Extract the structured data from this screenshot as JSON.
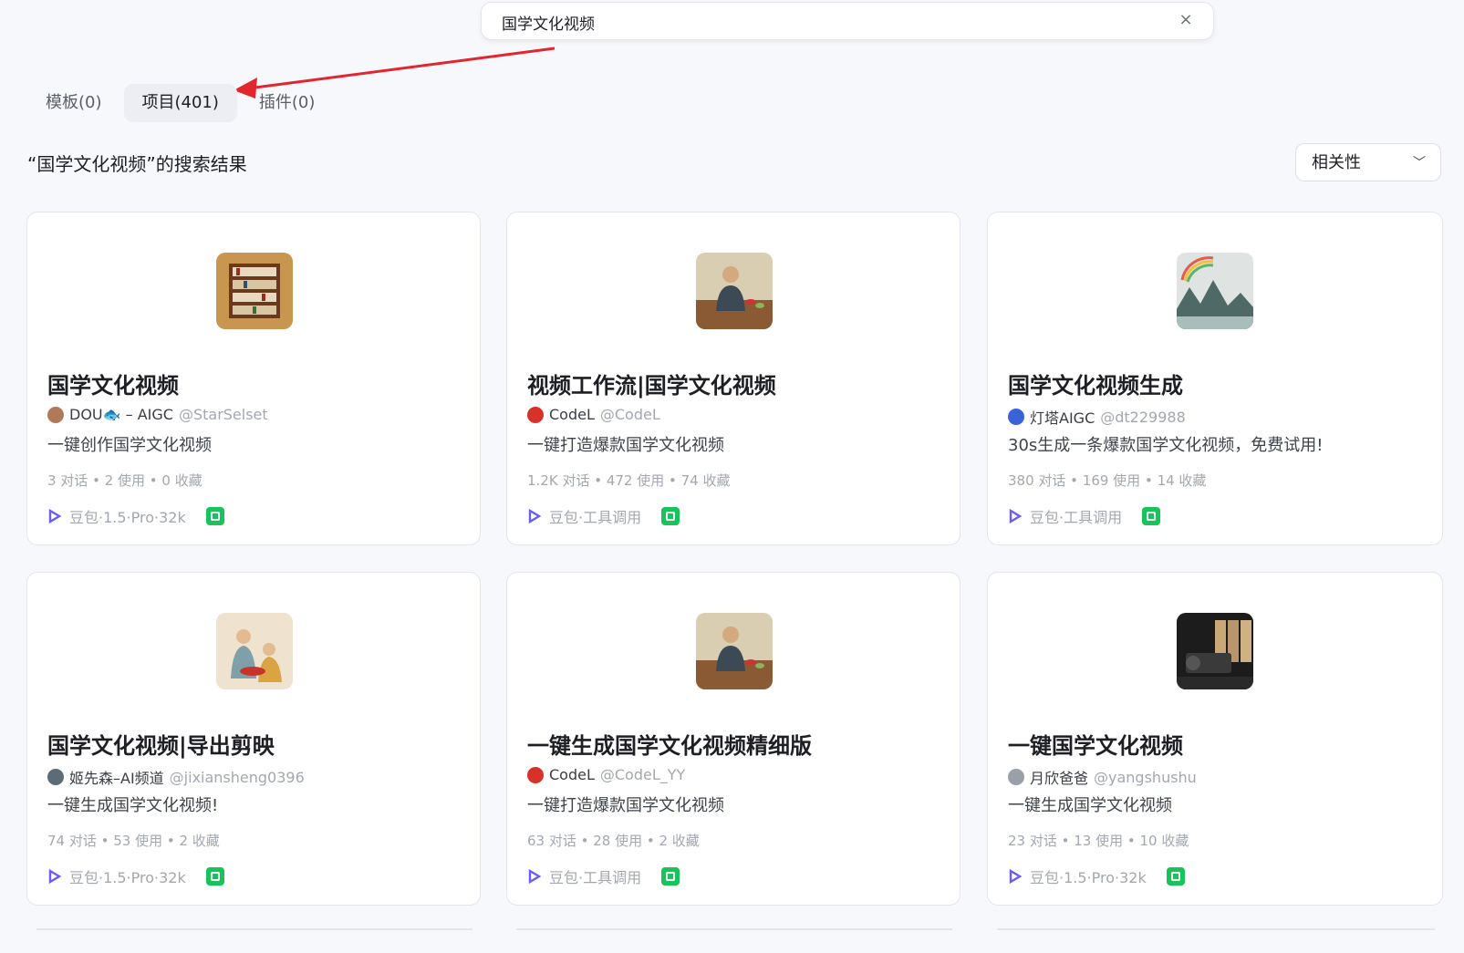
{
  "search": {
    "value": "国学文化视频",
    "clear_icon": "close-icon"
  },
  "tabs": [
    {
      "label": "模板(0)",
      "active": false
    },
    {
      "label": "项目(401)",
      "active": true
    },
    {
      "label": "插件(0)",
      "active": false
    }
  ],
  "results_title": "“国学文化视频”的搜索结果",
  "sort": {
    "selected": "相关性"
  },
  "cards": [
    {
      "title": "国学文化视频",
      "author": "DOU🐟 – AIGC",
      "handle": "@StarSelset",
      "desc": "一键创作国学文化视频",
      "stats": "3 对话 • 2 使用 • 0 收藏",
      "model": "豆包·1.5·Pro·32k"
    },
    {
      "title": "视频工作流|国学文化视频",
      "author": "CodeL",
      "handle": "@CodeL",
      "desc": "一键打造爆款国学文化视频",
      "stats": "1.2K 对话 • 472 使用 • 74 收藏",
      "model": "豆包·工具调用"
    },
    {
      "title": "国学文化视频生成",
      "author": "灯塔AIGC",
      "handle": "@dt229988",
      "desc": "30s生成一条爆款国学文化视频，免费试用!",
      "stats": "380 对话 • 169 使用 • 14 收藏",
      "model": "豆包·工具调用"
    },
    {
      "title": "国学文化视频|导出剪映",
      "author": "姬先森–AI频道",
      "handle": "@jixiansheng0396",
      "desc": "一键生成国学文化视频!",
      "stats": "74 对话 • 53 使用 • 2 收藏",
      "model": "豆包·1.5·Pro·32k"
    },
    {
      "title": "一键生成国学文化视频精细版",
      "author": "CodeL",
      "handle": "@CodeL_YY",
      "desc": "一键打造爆款国学文化视频",
      "stats": "63 对话 • 28 使用 • 2 收藏",
      "model": "豆包·工具调用"
    },
    {
      "title": "一键国学文化视频",
      "author": "月欣爸爸",
      "handle": "@yangshushu",
      "desc": "一键生成国学文化视频",
      "stats": "23 对话 • 13 使用 • 10 收藏",
      "model": "豆包·1.5·Pro·32k"
    }
  ],
  "colors": {
    "accent_red": "#e3262d",
    "plugin_green": "#17c35b"
  }
}
